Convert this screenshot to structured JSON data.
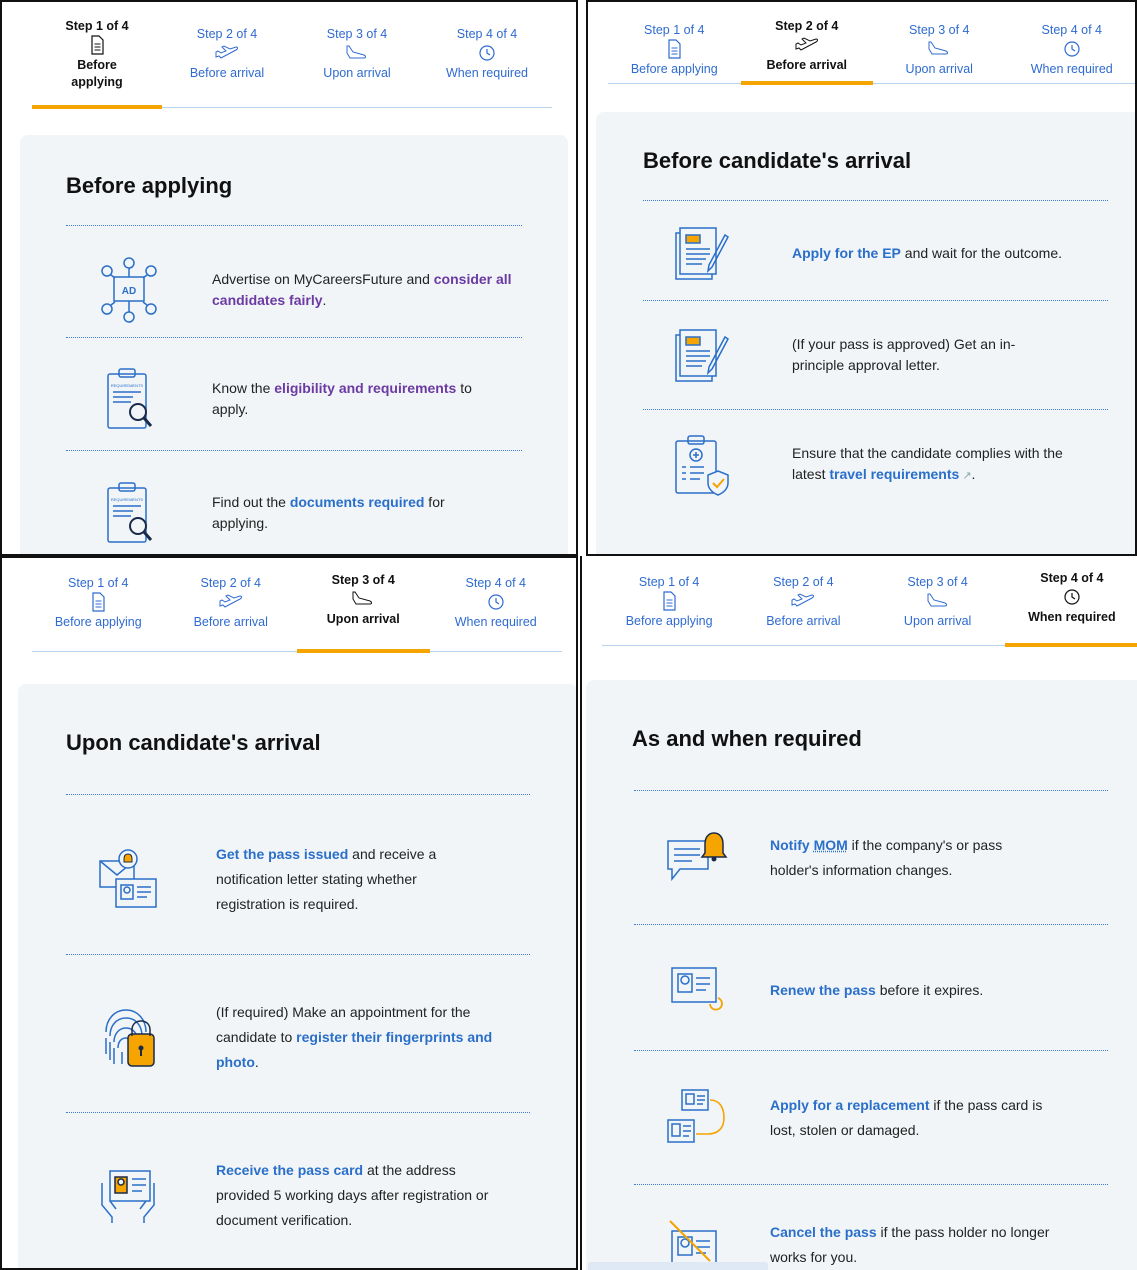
{
  "colors": {
    "link": "#2a6fc9",
    "visited_link": "#6b3aa3",
    "accent": "#f5a400",
    "card_bg": "#f1f5f8",
    "divider": "#3a7bd5"
  },
  "steps": [
    {
      "num": "Step 1 of 4",
      "label": "Before applying",
      "icon": "document-icon"
    },
    {
      "num": "Step 2 of 4",
      "label": "Before arrival",
      "icon": "plane-takeoff-icon"
    },
    {
      "num": "Step 3 of 4",
      "label": "Upon arrival",
      "icon": "plane-landing-icon"
    },
    {
      "num": "Step 4 of 4",
      "label": "When required",
      "icon": "clock-icon"
    }
  ],
  "panels": [
    {
      "title": "Before applying",
      "items": [
        {
          "icon": "advert-network-icon",
          "pre": "Advertise on MyCareersFuture and ",
          "link": "consider all candidates fairly",
          "post": "."
        },
        {
          "icon": "requirements-clipboard-icon",
          "pre": "Know the ",
          "link": "eligibility and requirements",
          "post": " to apply."
        },
        {
          "icon": "requirements-clipboard-icon",
          "pre": "Find out the ",
          "link": "documents required",
          "post": " for applying."
        }
      ]
    },
    {
      "title": "Before candidate's arrival",
      "items": [
        {
          "icon": "application-form-icon",
          "pre": "",
          "link": "Apply for the EP",
          "post": " and wait for the outcome."
        },
        {
          "icon": "application-form-icon",
          "pre": "(If your pass is approved) Get an in-principle approval letter.",
          "link": "",
          "post": ""
        },
        {
          "icon": "medical-clipboard-icon",
          "pre": "Ensure that the candidate complies with the latest ",
          "link": "travel requirements",
          "post": "."
        }
      ]
    },
    {
      "title": "Upon candidate's arrival",
      "items": [
        {
          "icon": "notification-card-icon",
          "pre": "",
          "link": "Get the pass issued",
          "post": " and receive a notification letter stating whether registration is required."
        },
        {
          "icon": "fingerprint-lock-icon",
          "pre": "(If required) Make an appointment for the candidate to ",
          "link": "register their fingerprints and photo",
          "post": "."
        },
        {
          "icon": "hands-card-icon",
          "pre": "",
          "link": "Receive the pass card",
          "post": " at the address provided 5 working days after registration or document verification."
        }
      ]
    },
    {
      "title": "As and when required",
      "items": [
        {
          "icon": "chat-bell-icon",
          "pre": "",
          "link": "Notify ",
          "abbr": "MOM",
          "post": " if the company's or pass holder's information changes."
        },
        {
          "icon": "renew-card-icon",
          "pre": "",
          "link": "Renew the pass",
          "post": " before it expires."
        },
        {
          "icon": "replace-card-icon",
          "pre": "",
          "link": "Apply for a replacement",
          "post": " if the pass card is lost, stolen or damaged."
        },
        {
          "icon": "cancel-card-icon",
          "pre": "",
          "link": "Cancel the pass",
          "post": " if the pass holder no longer works for you."
        }
      ]
    }
  ]
}
